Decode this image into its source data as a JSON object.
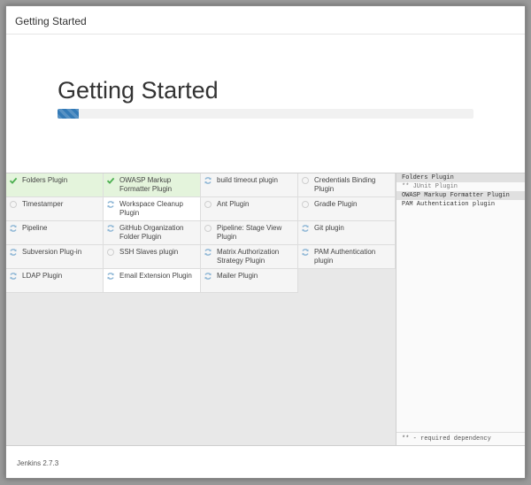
{
  "window": {
    "title": "Getting Started"
  },
  "hero": {
    "heading": "Getting Started",
    "progress_fraction": 0.05
  },
  "plugins": [
    {
      "label": "Folders Plugin",
      "status": "success"
    },
    {
      "label": "OWASP Markup Formatter Plugin",
      "status": "success"
    },
    {
      "label": "build timeout plugin",
      "status": "pending"
    },
    {
      "label": "Credentials Binding Plugin",
      "status": "idle"
    },
    {
      "label": "Timestamper",
      "status": "idle"
    },
    {
      "label": "Workspace Cleanup Plugin",
      "status": "pending"
    },
    {
      "label": "Ant Plugin",
      "status": "idle"
    },
    {
      "label": "Gradle Plugin",
      "status": "idle"
    },
    {
      "label": "Pipeline",
      "status": "pending"
    },
    {
      "label": "GitHub Organization Folder Plugin",
      "status": "pending"
    },
    {
      "label": "Pipeline: Stage View Plugin",
      "status": "idle"
    },
    {
      "label": "Git plugin",
      "status": "pending"
    },
    {
      "label": "Subversion Plug-in",
      "status": "pending"
    },
    {
      "label": "SSH Slaves plugin",
      "status": "idle"
    },
    {
      "label": "Matrix Authorization Strategy Plugin",
      "status": "pending"
    },
    {
      "label": "PAM Authentication plugin",
      "status": "pending"
    },
    {
      "label": "LDAP Plugin",
      "status": "pending"
    },
    {
      "label": "Email Extension Plugin",
      "status": "pending"
    },
    {
      "label": "Mailer Plugin",
      "status": "pending"
    }
  ],
  "log": {
    "lines": [
      {
        "text": "Folders Plugin",
        "style": "hl"
      },
      {
        "text": "** JUnit Plugin",
        "style": "dep"
      },
      {
        "text": "OWASP Markup Formatter Plugin",
        "style": "hl"
      },
      {
        "text": "PAM Authentication plugin",
        "style": ""
      }
    ],
    "legend": "** - required dependency"
  },
  "footer": {
    "version": "Jenkins 2.7.3"
  },
  "colors": {
    "accent": "#337ab7",
    "success": "#4caf50",
    "pending": "#8fb7d6",
    "idle": "#cfcfcf"
  }
}
